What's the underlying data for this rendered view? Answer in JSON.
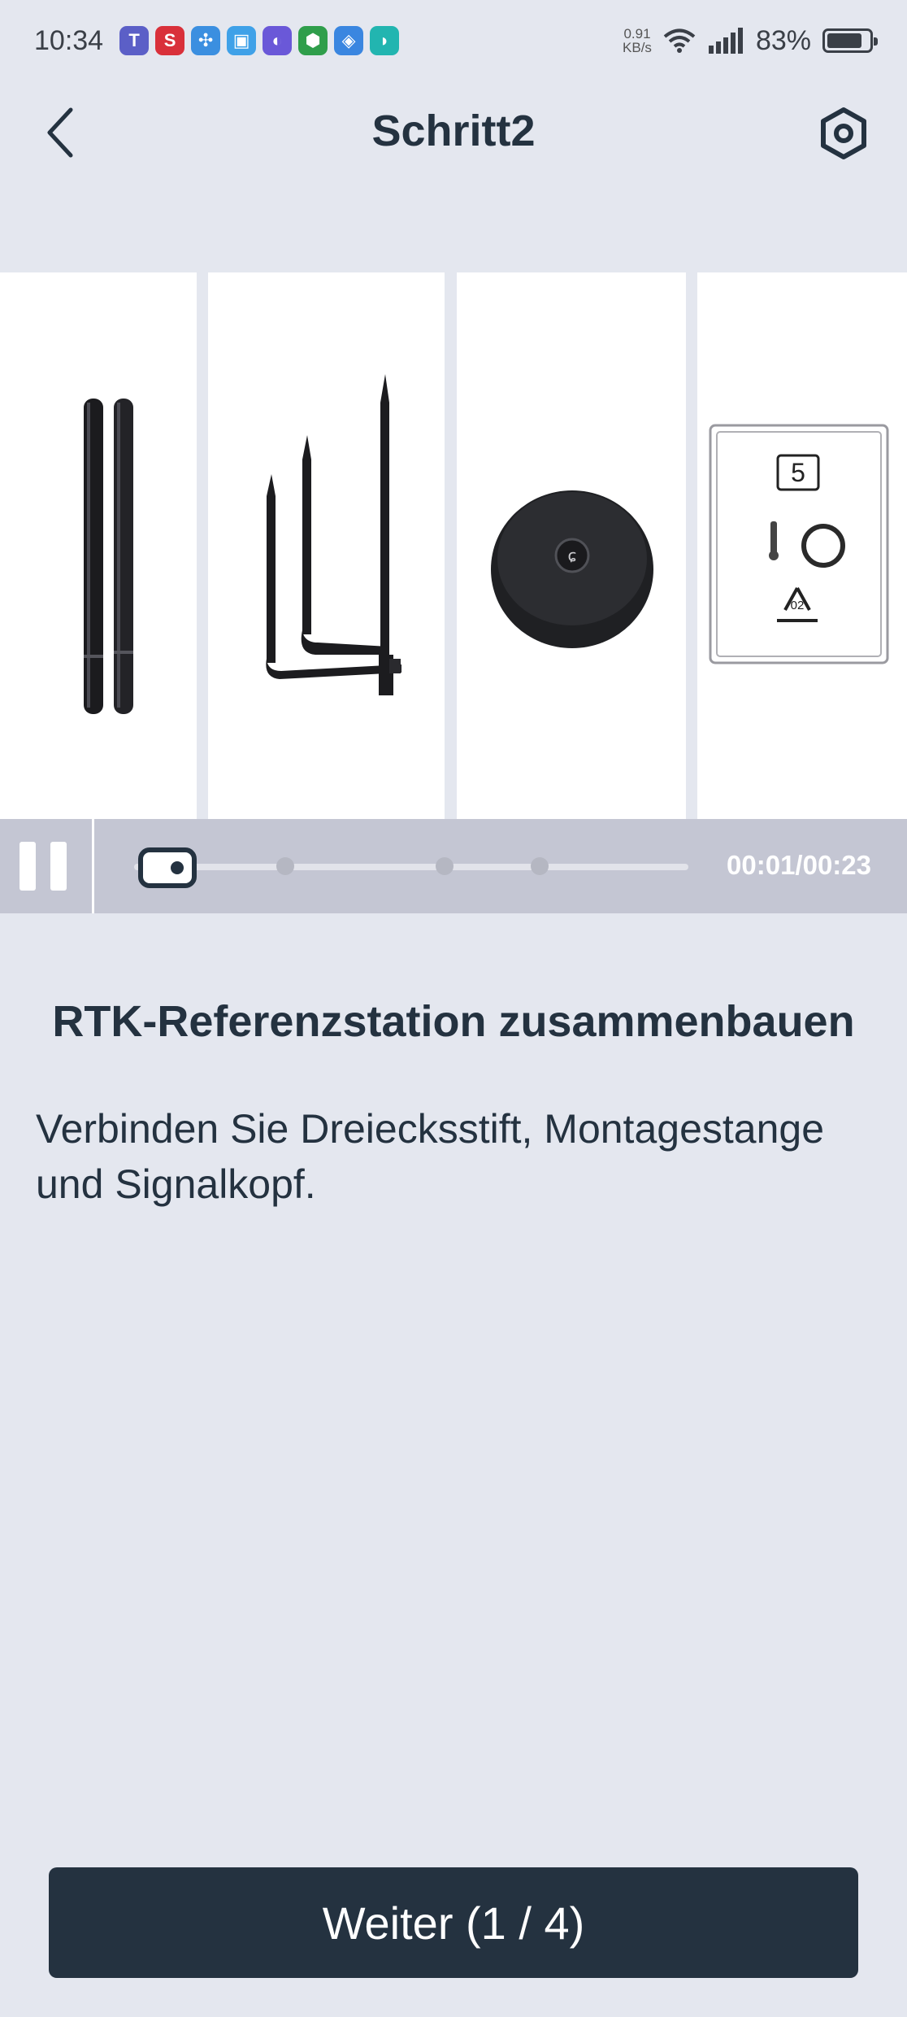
{
  "status_bar": {
    "time": "10:34",
    "net_speed_value": "0.91",
    "net_speed_unit": "KB/s",
    "battery": "83%",
    "battery_level": 0.83,
    "app_icons": [
      "teams-icon",
      "s-app-icon",
      "fan-app-icon",
      "clipboard-app-icon",
      "planet-app-icon",
      "shield-green-icon",
      "shield-blue-icon",
      "dolby-icon"
    ]
  },
  "header": {
    "title": "Schritt2",
    "back_icon": "chevron-left-icon",
    "settings_icon": "gear-icon"
  },
  "video": {
    "box_label": "5",
    "recycle_label": "02",
    "time": "00:01/00:23",
    "progress": 0.043
  },
  "content": {
    "heading": "RTK-Referenzstation zusammenbauen",
    "description": "Verbinden Sie Dreiecksstift, Montagestange und Signalkopf."
  },
  "footer": {
    "next_label": "Weiter (1 / 4)"
  }
}
